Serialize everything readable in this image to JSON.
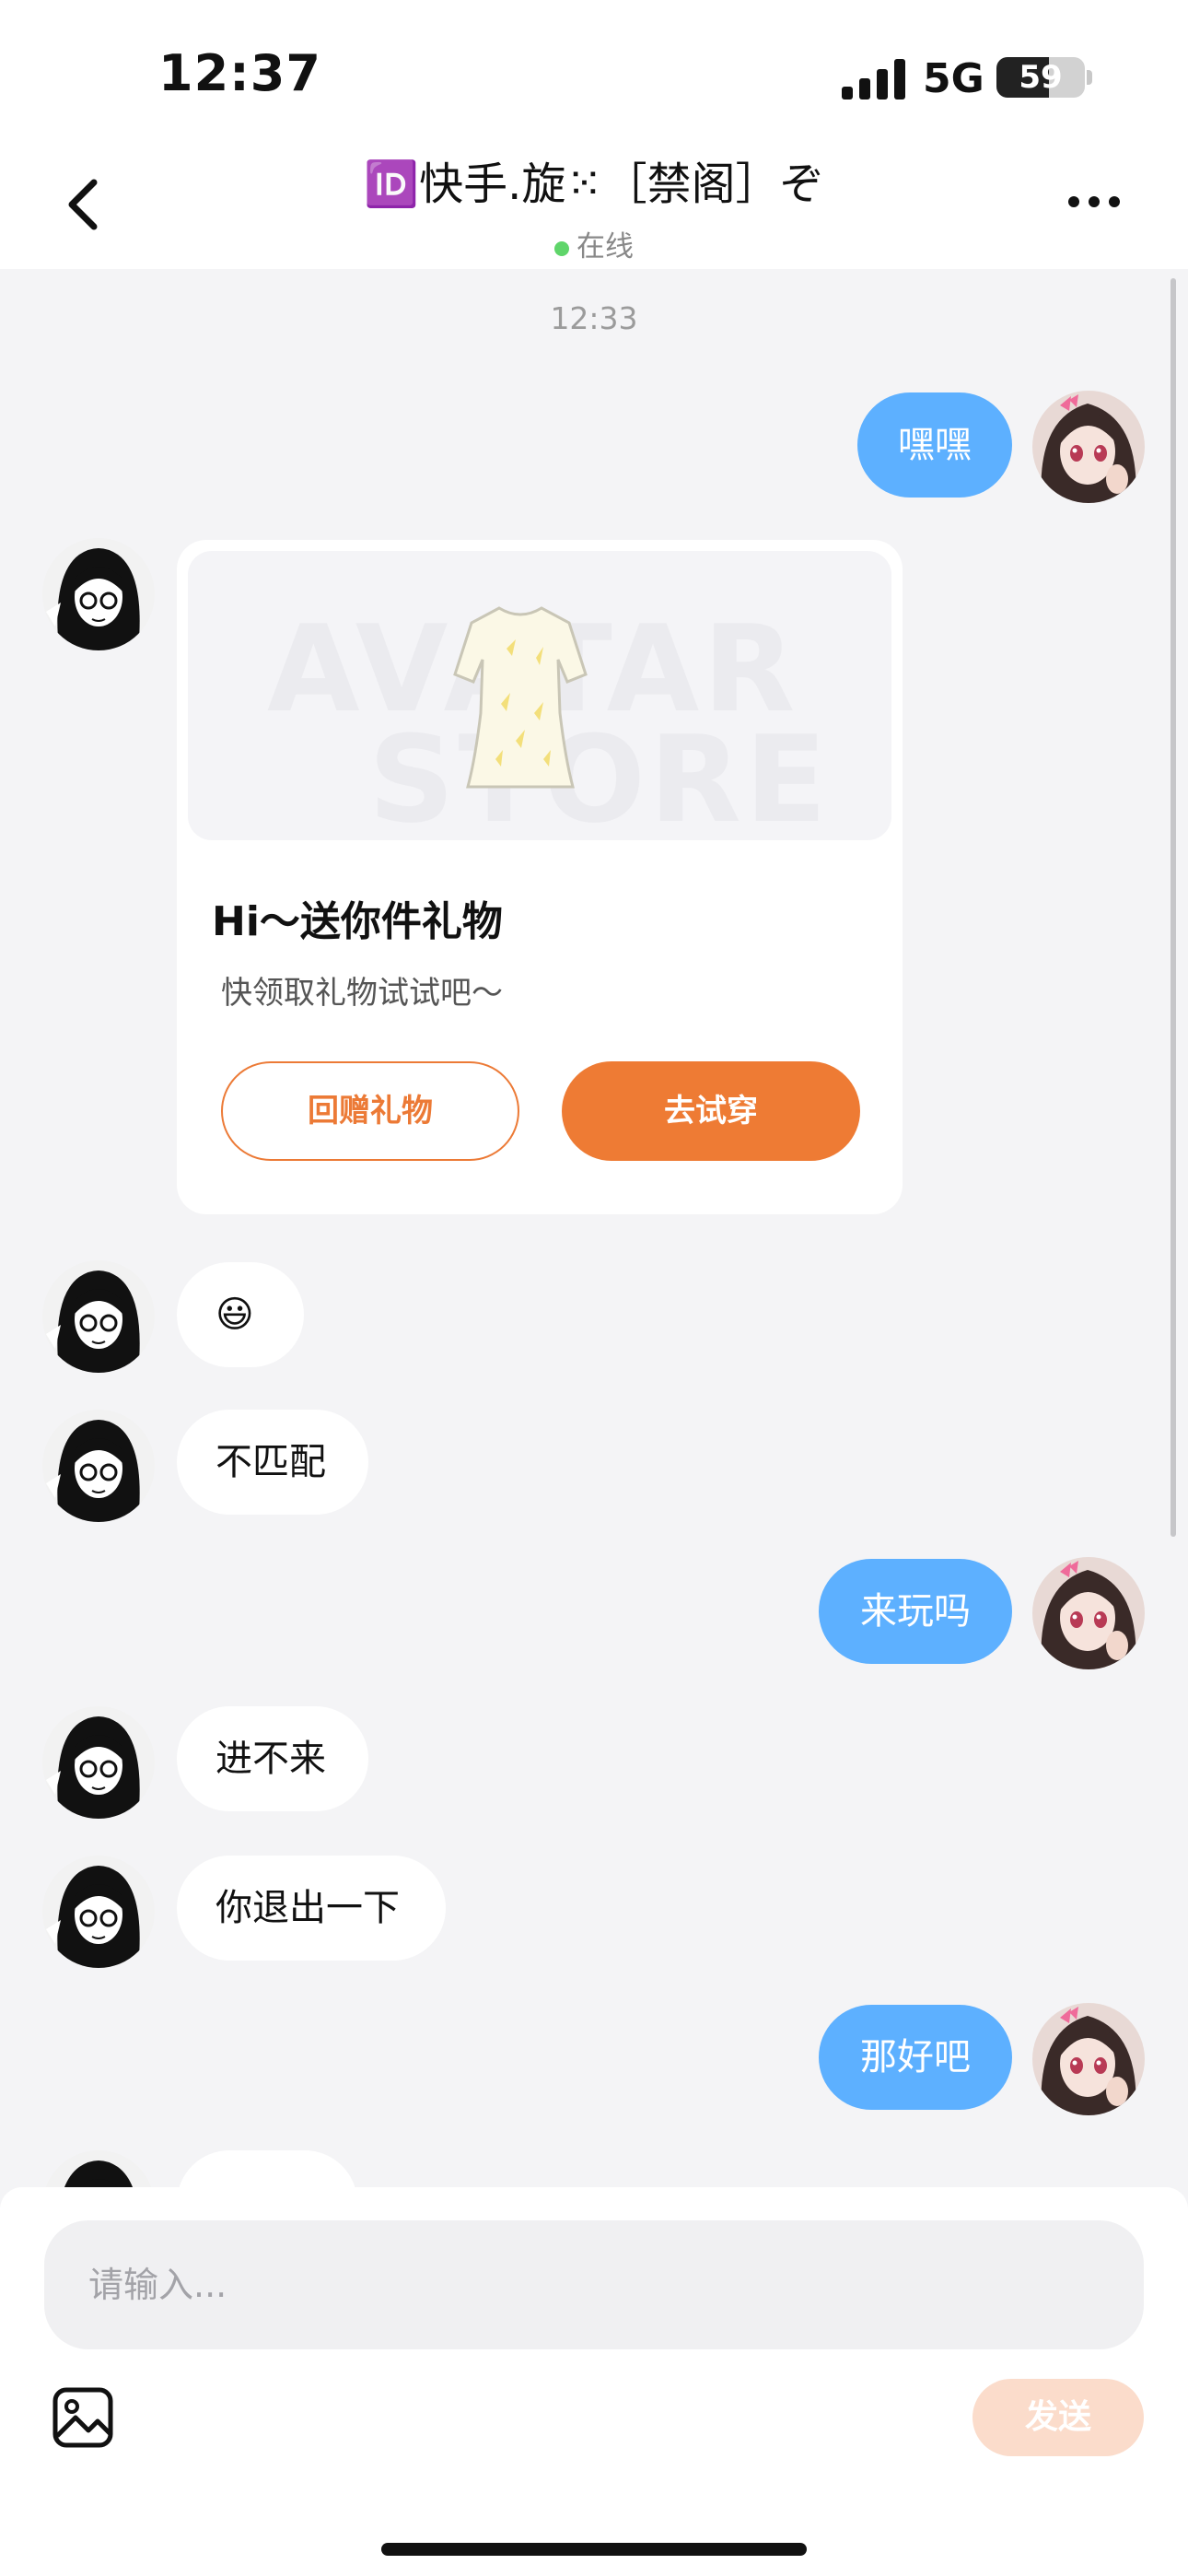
{
  "status_bar": {
    "time": "12:37",
    "network": "5G",
    "battery_level": 59,
    "battery_text": "59"
  },
  "nav": {
    "back_icon": "chevron-left-icon",
    "title": "🆔快手.旋⁙［禁阁］ぞ",
    "status_text": "在线",
    "more_icon": "ellipsis-icon"
  },
  "chat": {
    "timestamp": "12:33",
    "messages": [
      {
        "from": "me",
        "text": "嘿嘿"
      },
      {
        "from": "other",
        "type": "gift_card",
        "title": "Hi～送你件礼物",
        "subtitle": "快领取礼物试试吧～",
        "watermark": [
          "AVATAR",
          "STORE"
        ],
        "return_gift_label": "回赠礼物",
        "try_on_label": "去试穿"
      },
      {
        "from": "other",
        "text": "😃"
      },
      {
        "from": "other",
        "text": "不匹配"
      },
      {
        "from": "me",
        "text": "来玩吗"
      },
      {
        "from": "other",
        "text": "进不来"
      },
      {
        "from": "other",
        "text": "你退出一下"
      },
      {
        "from": "me",
        "text": "那好吧"
      }
    ]
  },
  "composer": {
    "placeholder": "请输入...",
    "image_icon": "image-icon",
    "send_label": "发送"
  },
  "colors": {
    "my_bubble": "#5db0ff",
    "accent": "#ee7b34",
    "send_disabled": "#fbdccb",
    "online_dot": "#5fd56a"
  }
}
